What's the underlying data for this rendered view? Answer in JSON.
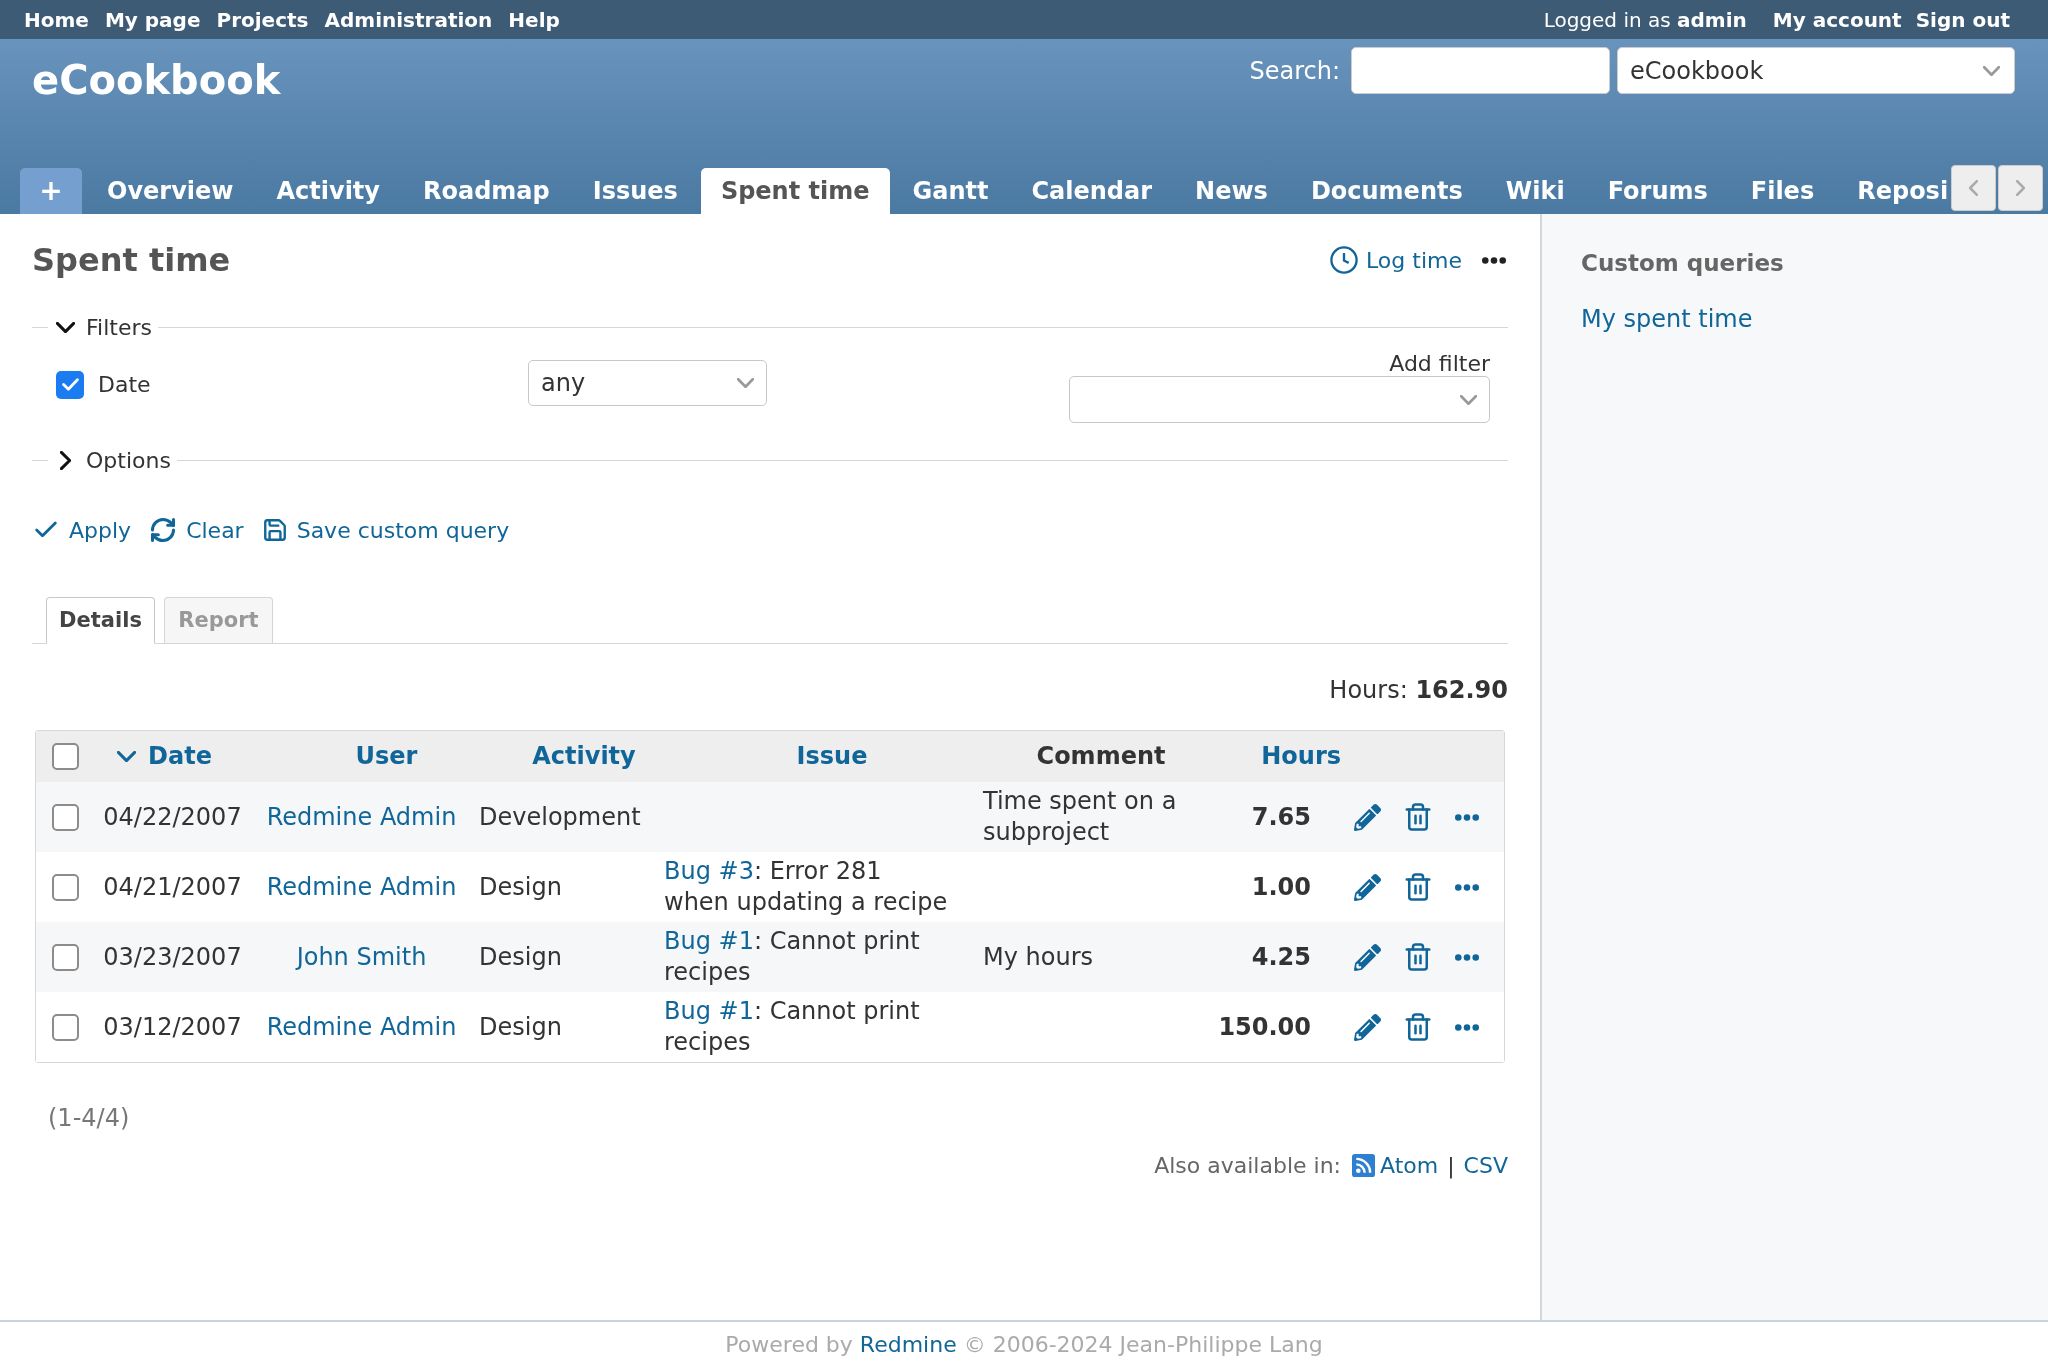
{
  "top_menu": {
    "items": [
      "Home",
      "My page",
      "Projects",
      "Administration",
      "Help"
    ],
    "logged_in": "Logged in as **admin**",
    "account_items": [
      "My account",
      "Sign out"
    ]
  },
  "header": {
    "title": "eCookbook",
    "search": {
      "label": "Search:"
    },
    "project_jump": {
      "value": "eCookbook"
    }
  },
  "main_menu": {
    "new_item": "+",
    "tabs": [
      {
        "label": "Overview",
        "selected": false
      },
      {
        "label": "Activity",
        "selected": false
      },
      {
        "label": "Roadmap",
        "selected": false
      },
      {
        "label": "Issues",
        "selected": false
      },
      {
        "label": "Spent time",
        "selected": true
      },
      {
        "label": "Gantt",
        "selected": false
      },
      {
        "label": "Calendar",
        "selected": false
      },
      {
        "label": "News",
        "selected": false
      },
      {
        "label": "Documents",
        "selected": false
      },
      {
        "label": "Wiki",
        "selected": false
      },
      {
        "label": "Forums",
        "selected": false
      },
      {
        "label": "Files",
        "selected": false
      },
      {
        "label": "Reposi",
        "selected": false
      }
    ]
  },
  "page_title": "Spent time",
  "contextual": {
    "log_time": "Log time"
  },
  "filters": {
    "legend": "Filters",
    "expanded": true,
    "rows": [
      {
        "label": "Date",
        "checked": true,
        "operator": "any"
      }
    ],
    "add_filter": {
      "label": "Add filter"
    }
  },
  "options": {
    "legend": "Options",
    "expanded": false
  },
  "query_buttons": [
    {
      "kind": "apply",
      "label": "Apply"
    },
    {
      "kind": "clear",
      "label": "Clear"
    },
    {
      "kind": "save",
      "label": "Save custom query"
    }
  ],
  "view_tabs": [
    {
      "label": "Details",
      "selected": true
    },
    {
      "label": "Report",
      "selected": false
    }
  ],
  "total": "Hours: **162.90**",
  "table": {
    "select_all": {
      "checked": false
    },
    "columns": [
      {
        "label": "Date",
        "sortable": true,
        "sorted": true
      },
      {
        "label": "User",
        "sortable": true,
        "sorted": false
      },
      {
        "label": "Activity",
        "sortable": true,
        "sorted": false
      },
      {
        "label": "Issue",
        "sortable": true,
        "sorted": false
      },
      {
        "label": "Comment",
        "sortable": false,
        "sorted": false
      },
      {
        "label": "Hours",
        "sortable": true,
        "sorted": false
      }
    ],
    "rows": [
      {
        "checked": false,
        "date": "04/22/2007",
        "user": "Redmine Admin",
        "activity": "Development",
        "comment": "Time spent on a subproject",
        "hours": "7.65"
      },
      {
        "checked": false,
        "date": "04/21/2007",
        "user": "Redmine Admin",
        "activity": "Design",
        "issue": {
          "link": "Bug #3",
          "subject": ": Error 281 when updating a recipe"
        },
        "hours": "1.00"
      },
      {
        "checked": false,
        "date": "03/23/2007",
        "user": "John Smith",
        "activity": "Design",
        "issue": {
          "link": "Bug #1",
          "subject": ": Cannot print recipes"
        },
        "comment": "My hours",
        "hours": "4.25"
      },
      {
        "checked": false,
        "date": "03/12/2007",
        "user": "Redmine Admin",
        "activity": "Design",
        "issue": {
          "link": "Bug #1",
          "subject": ": Cannot print recipes"
        },
        "hours": "150.00"
      }
    ]
  },
  "pagination": "(1-4/4)",
  "export": {
    "label": "Also available in:",
    "links": [
      {
        "label": "Atom",
        "kind": "feed"
      },
      {
        "label": "CSV",
        "kind": "plain"
      }
    ],
    "separator": "|"
  },
  "sidebar": {
    "title": "Custom queries",
    "links": [
      "My spent time"
    ]
  },
  "footer": {
    "before": "Powered by",
    "link": "Redmine",
    "after": "© 2006-2024 Jean-Philippe Lang"
  }
}
